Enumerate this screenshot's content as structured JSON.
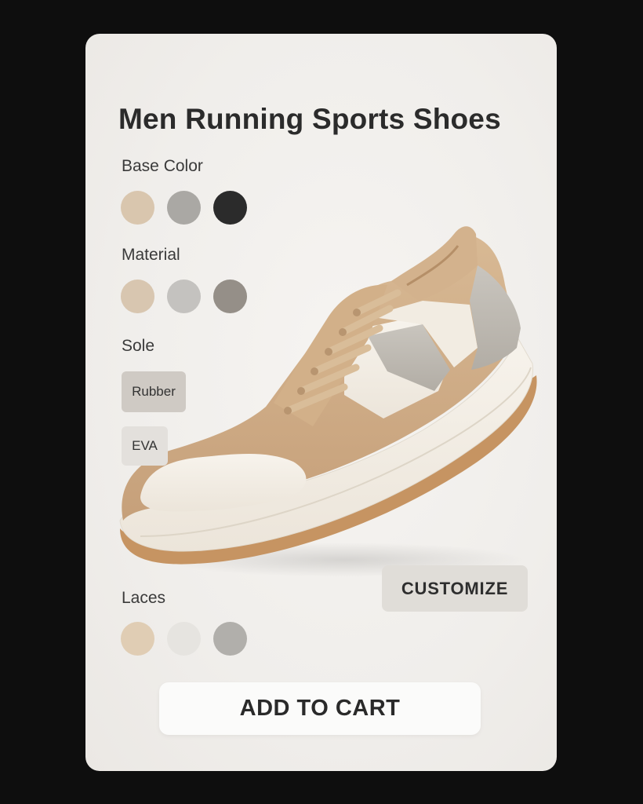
{
  "product": {
    "title": "Men Running Sports Shoes"
  },
  "base_color": {
    "label": "Base Color",
    "options": [
      "#d9c6ae",
      "#aaa8a4",
      "#2b2b2b"
    ]
  },
  "material": {
    "label": "Material",
    "options": [
      "#d8c6b0",
      "#c4c2bf",
      "#958f88"
    ]
  },
  "sole": {
    "label": "Sole",
    "options": [
      "Rubber",
      "EVA"
    ]
  },
  "laces": {
    "label": "Laces",
    "options": [
      "#e0cdb4",
      "#e6e4e0",
      "#b1afab"
    ]
  },
  "actions": {
    "customize_label": "CUSTOMIZE",
    "add_to_cart_label": "ADD TO CART"
  }
}
